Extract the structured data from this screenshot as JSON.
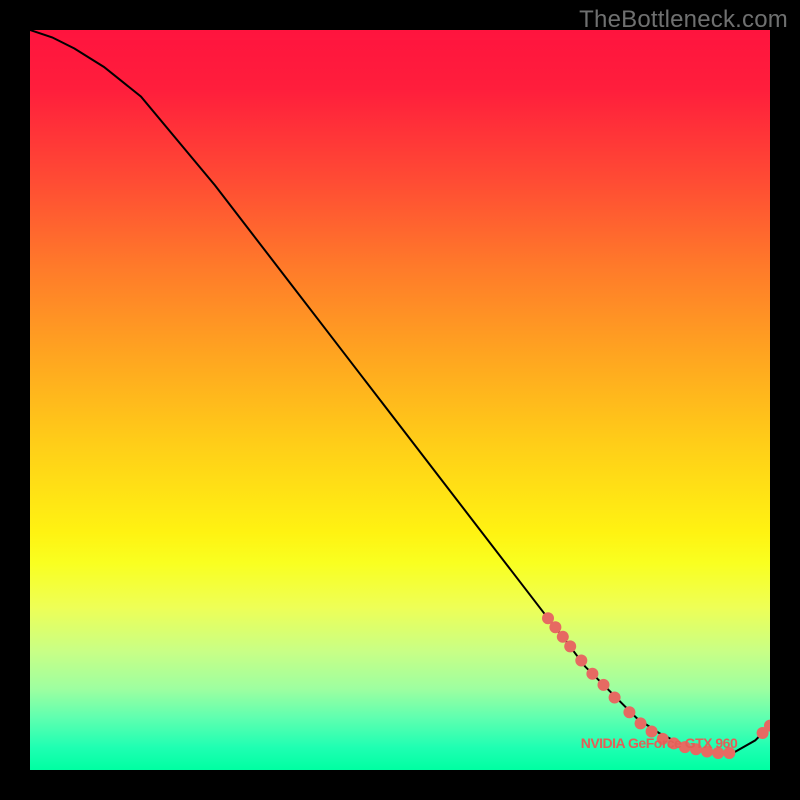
{
  "watermark": "TheBottleneck.com",
  "chart_data": {
    "type": "line",
    "title": "",
    "xlabel": "",
    "ylabel": "",
    "xlim": [
      0,
      100
    ],
    "ylim": [
      0,
      100
    ],
    "grid": false,
    "legend": false,
    "background": "rainbow-gradient red→green",
    "series": [
      {
        "name": "curve",
        "x": [
          0,
          3,
          6,
          10,
          15,
          20,
          25,
          30,
          35,
          40,
          45,
          50,
          55,
          60,
          65,
          70,
          72,
          75,
          78,
          80,
          82,
          85,
          88,
          90,
          92,
          95,
          98,
          100
        ],
        "y": [
          100,
          99,
          97.5,
          95,
          91,
          85,
          79,
          72.5,
          66,
          59.5,
          53,
          46.5,
          40,
          33.5,
          27,
          20.5,
          18,
          14,
          11,
          9,
          7,
          5,
          3.5,
          2.8,
          2.3,
          2.3,
          4,
          6
        ],
        "color": "#000000"
      }
    ],
    "markers": [
      {
        "x": 70,
        "y": 20.5
      },
      {
        "x": 71,
        "y": 19.3
      },
      {
        "x": 72,
        "y": 18
      },
      {
        "x": 73,
        "y": 16.7
      },
      {
        "x": 74.5,
        "y": 14.8
      },
      {
        "x": 76,
        "y": 13
      },
      {
        "x": 77.5,
        "y": 11.5
      },
      {
        "x": 79,
        "y": 9.8
      },
      {
        "x": 81,
        "y": 7.8
      },
      {
        "x": 82.5,
        "y": 6.3
      },
      {
        "x": 84,
        "y": 5.2
      },
      {
        "x": 85.5,
        "y": 4.2
      },
      {
        "x": 87,
        "y": 3.6
      },
      {
        "x": 88.5,
        "y": 3.1
      },
      {
        "x": 90,
        "y": 2.8
      },
      {
        "x": 91.5,
        "y": 2.5
      },
      {
        "x": 93,
        "y": 2.3
      },
      {
        "x": 94.5,
        "y": 2.3
      },
      {
        "x": 99,
        "y": 5
      },
      {
        "x": 100,
        "y": 6
      }
    ],
    "annotations": [
      {
        "text": "NVIDIA GeForce GTX 960",
        "x": 85,
        "y": 3
      }
    ],
    "colors": {
      "marker": "#e66a62",
      "annotation": "#e26058"
    }
  }
}
